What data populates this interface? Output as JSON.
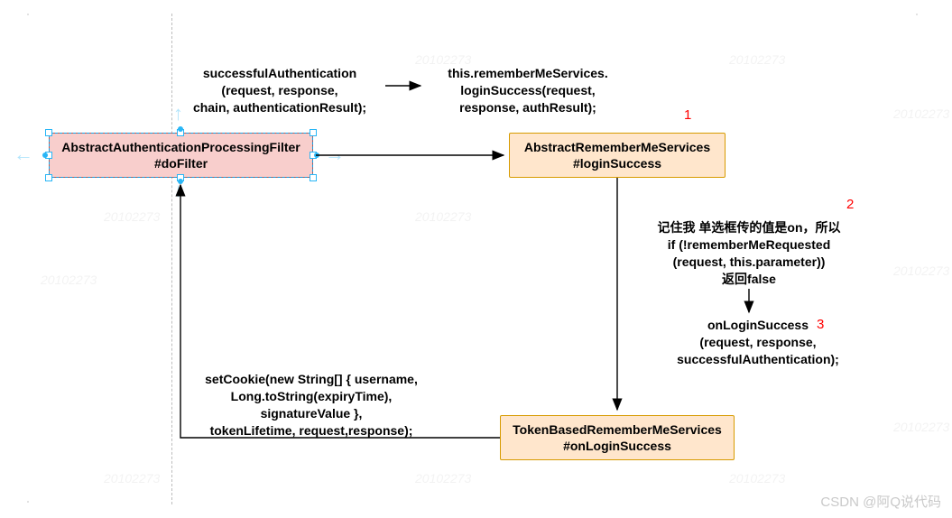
{
  "boxes": {
    "filter": {
      "line1": "AbstractAuthenticationProcessingFilter",
      "line2": "#doFilter"
    },
    "remember": {
      "line1": "AbstractRememberMeServices",
      "line2": "#loginSuccess"
    },
    "token": {
      "line1": "TokenBasedRememberMeServices",
      "line2": "#onLoginSuccess"
    }
  },
  "labels": {
    "successAuth": {
      "l1": "successfulAuthentication",
      "l2": "(request, response,",
      "l3": "chain, authenticationResult);"
    },
    "rememberCall": {
      "l1": "this.rememberMeServices.",
      "l2": "loginSuccess(request,",
      "l3": "response, authResult);"
    },
    "ifBlock": {
      "l1": "记住我 单选框传的值是on，所以",
      "l2": "if (!rememberMeRequested",
      "l3": "(request, this.parameter))",
      "l4": "返回false"
    },
    "onLogin": {
      "l1": "onLoginSuccess",
      "l2": "(request, response,",
      "l3": "successfulAuthentication);"
    },
    "setCookie": {
      "l1": "setCookie(new String[] { username,",
      "l2": "Long.toString(expiryTime),",
      "l3": "signatureValue },",
      "l4": "tokenLifetime, request,response);"
    }
  },
  "badges": {
    "one": "1",
    "two": "2",
    "three": "3"
  },
  "watermark": "20102273",
  "credit": "CSDN @阿Q说代码"
}
